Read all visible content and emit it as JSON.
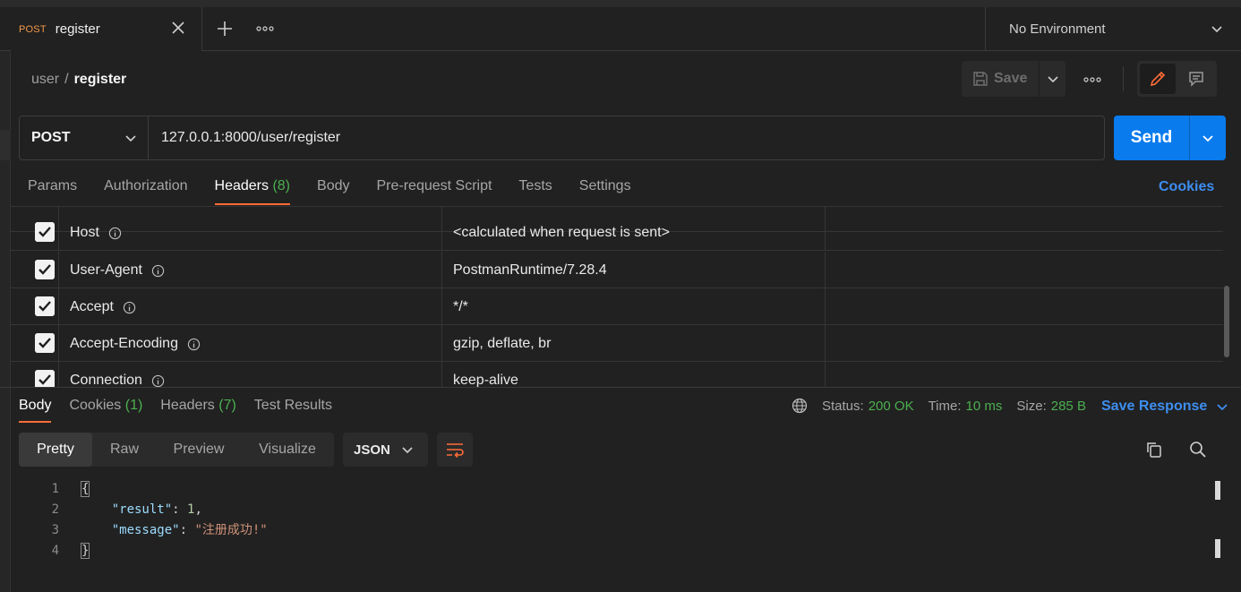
{
  "tab": {
    "method": "POST",
    "name": "register"
  },
  "environment": {
    "label": "No Environment"
  },
  "breadcrumb": {
    "parent": "user",
    "separator": "/",
    "current": "register"
  },
  "toolbar": {
    "save_label": "Save"
  },
  "request": {
    "method": "POST",
    "url": "127.0.0.1:8000/user/register",
    "send_label": "Send"
  },
  "request_tabs": [
    {
      "label": "Params"
    },
    {
      "label": "Authorization"
    },
    {
      "label": "Headers",
      "count": "(8)"
    },
    {
      "label": "Body"
    },
    {
      "label": "Pre-request Script"
    },
    {
      "label": "Tests"
    },
    {
      "label": "Settings"
    }
  ],
  "cookies_link": "Cookies",
  "headers": [
    {
      "key": "Host",
      "value": "<calculated when request is sent>"
    },
    {
      "key": "User-Agent",
      "value": "PostmanRuntime/7.28.4"
    },
    {
      "key": "Accept",
      "value": "*/*"
    },
    {
      "key": "Accept-Encoding",
      "value": "gzip, deflate, br"
    },
    {
      "key": "Connection",
      "value": "keep-alive"
    }
  ],
  "response_tabs": [
    {
      "label": "Body"
    },
    {
      "label": "Cookies",
      "count": "(1)"
    },
    {
      "label": "Headers",
      "count": "(7)"
    },
    {
      "label": "Test Results"
    }
  ],
  "response_meta": {
    "status_label": "Status:",
    "status": "200 OK",
    "time_label": "Time:",
    "time": "10 ms",
    "size_label": "Size:",
    "size": "285 B"
  },
  "save_response": "Save Response",
  "view_modes": [
    "Pretty",
    "Raw",
    "Preview",
    "Visualize"
  ],
  "format": "JSON",
  "code": {
    "line_numbers": [
      "1",
      "2",
      "3",
      "4"
    ],
    "open_brace": "{",
    "close_brace": "}",
    "result_key": "\"result\"",
    "result_value": "1",
    "message_key": "\"message\"",
    "message_value": "\"注册成功!\""
  },
  "colors": {
    "accent": "#ff6c37",
    "send": "#097bed",
    "link": "#3d8ef0",
    "success": "#4caf50"
  }
}
